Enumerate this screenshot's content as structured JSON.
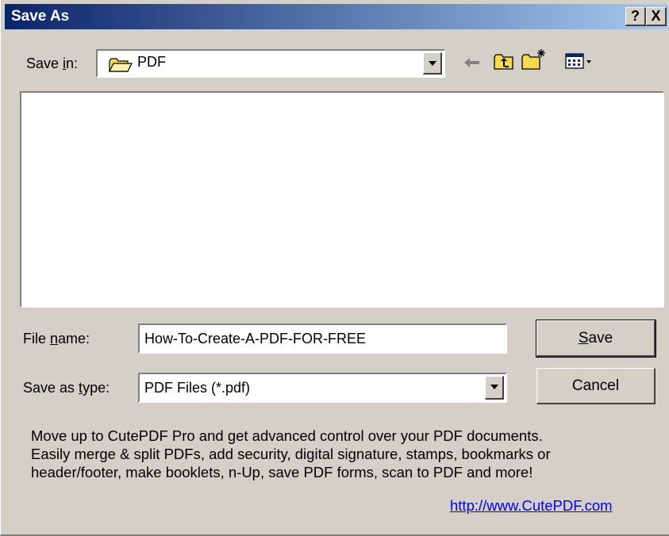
{
  "window": {
    "title": "Save As",
    "help_button": "?",
    "close_button": "X"
  },
  "save_in": {
    "label_pre": "Save ",
    "label_acc": "i",
    "label_post": "n:",
    "value": "PDF",
    "icon": "folder-icon"
  },
  "toolbar": {
    "back_icon": "arrow-left-icon",
    "up_icon": "folder-up-icon",
    "new_folder_icon": "new-folder-icon",
    "view_icon": "view-menu-icon"
  },
  "file_name": {
    "label_pre": "File ",
    "label_acc": "n",
    "label_post": "ame:",
    "value": "How-To-Create-A-PDF-FOR-FREE"
  },
  "save_as_type": {
    "label_pre": "Save as ",
    "label_acc": "t",
    "label_post": "ype:",
    "value": "PDF Files (*.pdf)"
  },
  "buttons": {
    "save_acc": "S",
    "save_rest": "ave",
    "cancel": "Cancel"
  },
  "promo": {
    "line1": "Move up to CutePDF Pro and get advanced control over your PDF documents.",
    "line2": "Easily merge & split PDFs, add security, digital signature, stamps, bookmarks or",
    "line3": "header/footer, make booklets, n-Up, save PDF forms, scan to PDF and more!",
    "link": "http://www.CutePDF.com"
  },
  "colors": {
    "titlebar_start": "#0a246a",
    "titlebar_end": "#a6caf0",
    "face": "#d4d0c8",
    "link": "#0000ff"
  }
}
